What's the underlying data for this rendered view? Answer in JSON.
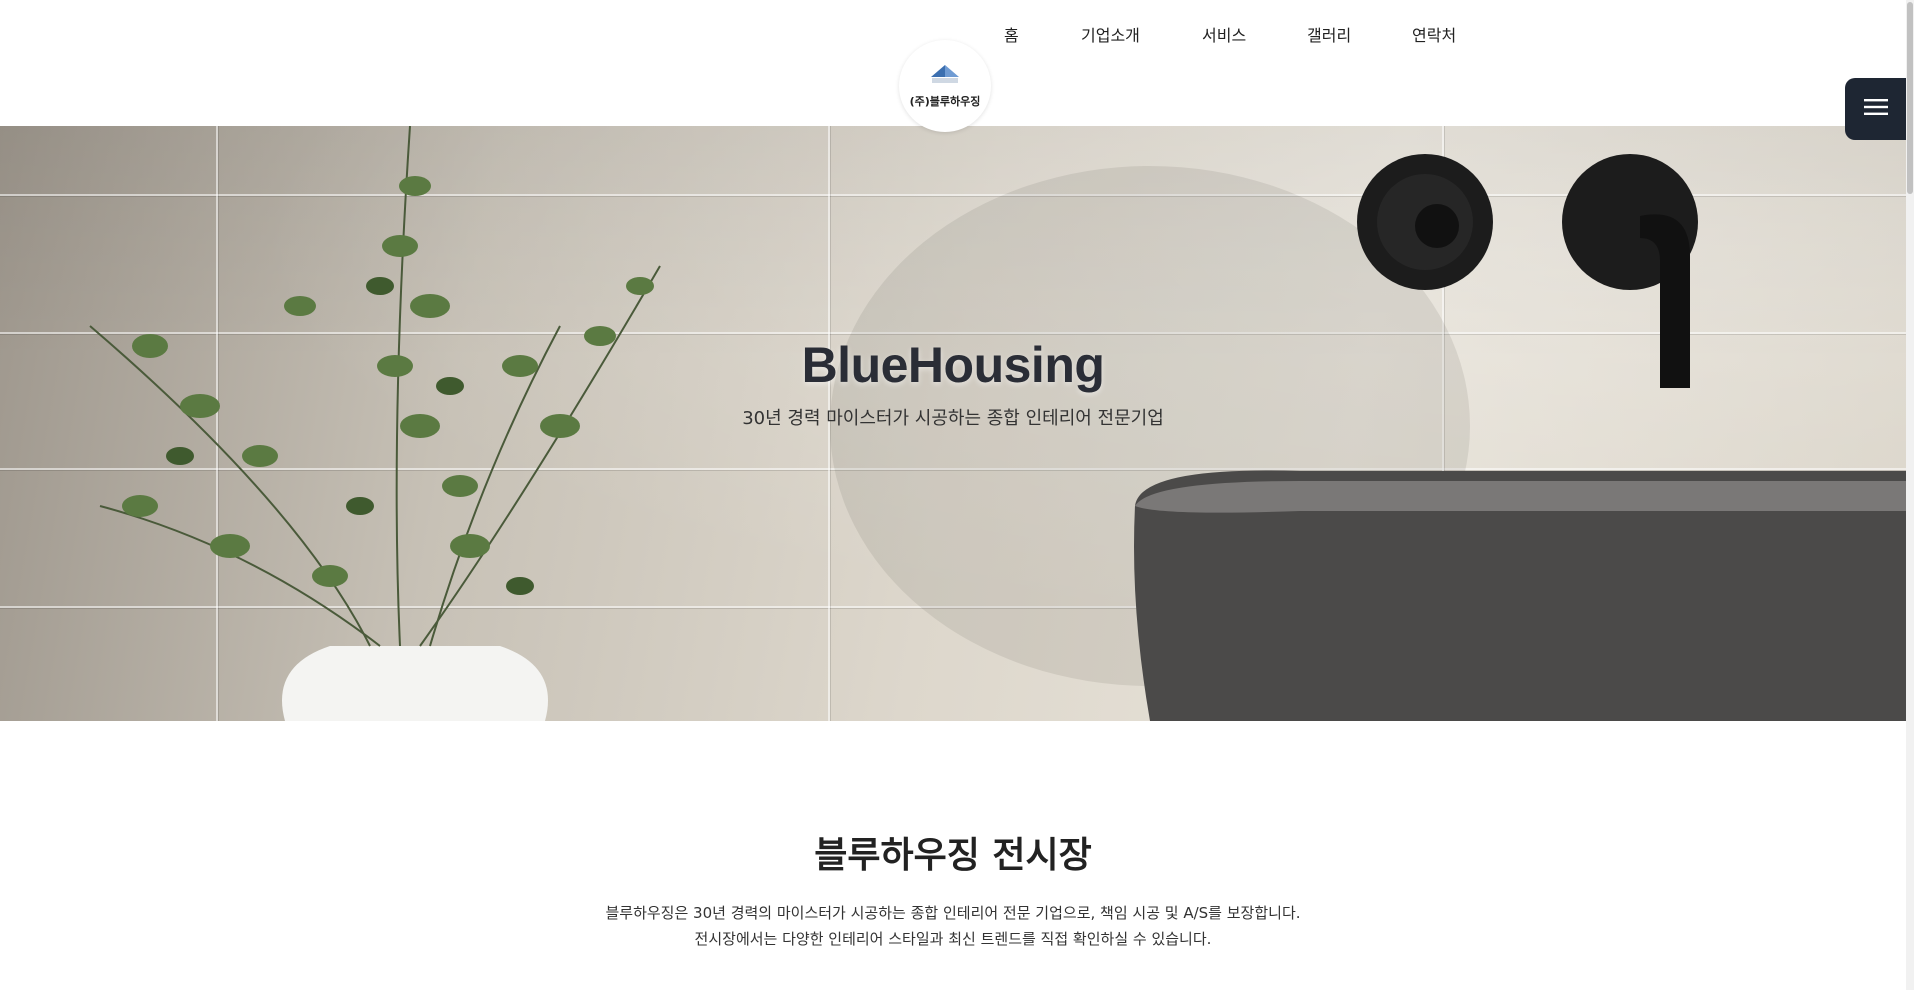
{
  "nav": {
    "items": [
      {
        "label": "홈"
      },
      {
        "label": "기업소개"
      },
      {
        "label": "서비스"
      },
      {
        "label": "갤러리"
      },
      {
        "label": "연락처"
      }
    ]
  },
  "logo": {
    "text": "(주)블루하우징",
    "icon": "house-roof-icon"
  },
  "menu_button": {
    "icon": "hamburger-menu-icon"
  },
  "hero": {
    "title": "BlueHousing",
    "subtitle": "30년 경력 마이스터가 시공하는 종합 인테리어 전문기업",
    "image": "bathroom-plant-sink-photo"
  },
  "showroom": {
    "title": "블루하우징 전시장",
    "line1": "블루하우징은 30년 경력의 마이스터가 시공하는 종합 인테리어 전문 기업으로, 책임 시공 및 A/S를 보장합니다.",
    "line2": "전시장에서는 다양한 인테리어 스타일과 최신 트렌드를 직접 확인하실 수 있습니다."
  },
  "colors": {
    "menu_button_bg": "#1e2633",
    "logo_blue": "#3b6fb0",
    "text_dark": "#222222"
  }
}
